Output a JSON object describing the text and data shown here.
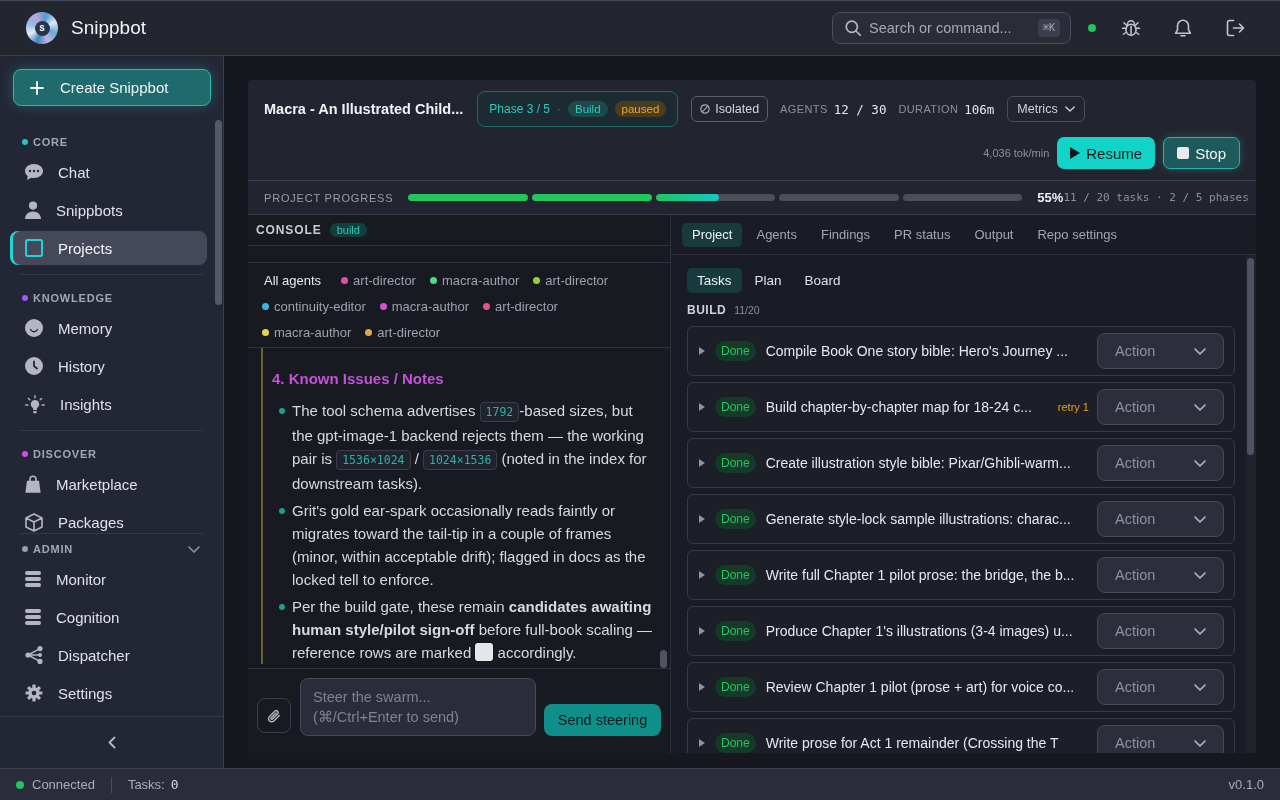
{
  "topbar": {
    "logo_letter": "s",
    "app_name": "Snippbot",
    "search": {
      "placeholder": "Search or command...",
      "shortcut": "⌘K"
    },
    "online": true
  },
  "sidebar": {
    "create_button": "Create Snippbot",
    "sections": [
      {
        "label": "CORE",
        "color": "#22c5c9",
        "items": [
          {
            "label": "Chat",
            "selected": false
          },
          {
            "label": "Snippbots",
            "selected": false
          },
          {
            "label": "Projects",
            "selected": true
          }
        ]
      },
      {
        "label": "KNOWLEDGE",
        "color": "#a855f7",
        "items": [
          {
            "label": "Memory",
            "selected": false
          },
          {
            "label": "History",
            "selected": false
          },
          {
            "label": "Insights",
            "selected": false
          }
        ]
      },
      {
        "label": "DISCOVER",
        "color": "#d14fe0",
        "items": [
          {
            "label": "Marketplace",
            "selected": false
          },
          {
            "label": "Packages",
            "selected": false
          }
        ]
      }
    ],
    "admin": {
      "label": "ADMIN",
      "color": "#9a9dab",
      "expanded": true,
      "items": [
        {
          "label": "Monitor",
          "selected": false
        },
        {
          "label": "Cognition",
          "selected": false
        },
        {
          "label": "Dispatcher",
          "selected": false
        },
        {
          "label": "Settings",
          "selected": false
        }
      ]
    }
  },
  "project": {
    "title": "Macra - An Illustrated Child...",
    "phase": "Phase 3 / 5",
    "separator": "·",
    "stage": "Build",
    "state": "paused",
    "isolation": "Isolated",
    "agents_label": "AGENTS",
    "agents": "12 / 30",
    "duration_label": "DURATION",
    "duration": "106m",
    "metrics_button": "Metrics",
    "token_rate": "4,036 tok/min",
    "buttons": [
      {
        "kind": "resume",
        "label": "Resume"
      },
      {
        "kind": "stop",
        "label": "Stop"
      }
    ]
  },
  "progress": {
    "label": "PROJECT PROGRESS",
    "segments": [
      {
        "kind": "done"
      },
      {
        "kind": "done"
      },
      {
        "kind": "active",
        "level": 0.53
      },
      {
        "kind": "pending"
      },
      {
        "kind": "pending"
      }
    ],
    "percent": "55%",
    "summary": "11 / 20 tasks · 2 / 5 phases"
  },
  "console": {
    "title": "CONSOLE",
    "stage": "build",
    "filters": [
      {
        "label": "All agents",
        "selected": true
      },
      {
        "label": "art-director",
        "color": "#e54e9f",
        "selected": false
      },
      {
        "label": "macra-author",
        "color": "#4ade80",
        "selected": false
      },
      {
        "label": "art-director",
        "color": "#8fd13f",
        "selected": false
      },
      {
        "label": "continuity-editor",
        "color": "#3bb4e0",
        "selected": false
      },
      {
        "label": "macra-author",
        "color": "#d351e0",
        "selected": false
      },
      {
        "label": "art-director",
        "color": "#e8508a",
        "selected": false
      },
      {
        "label": "macra-author",
        "color": "#e7d34a",
        "selected": false
      },
      {
        "label": "art-director",
        "color": "#e0a84a",
        "selected": false
      }
    ],
    "notes": {
      "heading": "4. Known Issues / Notes",
      "bullets": [
        [
          {
            "kind": "text",
            "text": "The tool schema advertises "
          },
          {
            "kind": "code",
            "text": "1792"
          },
          {
            "kind": "text",
            "text": "-based sizes, but the gpt-image-1 backend rejects them — the working pair is "
          },
          {
            "kind": "code",
            "text": "1536×1024"
          },
          {
            "kind": "text",
            "text": " / "
          },
          {
            "kind": "code",
            "text": "1024×1536"
          },
          {
            "kind": "text",
            "text": " (noted in the index for downstream tasks)."
          }
        ],
        [
          {
            "kind": "text",
            "text": "Grit's gold ear-spark occasionally reads faintly or migrates toward the tail-tip in a couple of frames (minor, within acceptable drift); flagged in docs as the locked tell to enforce."
          }
        ],
        [
          {
            "kind": "text",
            "text": "Per the build gate, these remain **candidates awaiting human style/pilot sign-off** before full-book scaling — reference rows are marked "
          },
          {
            "kind": "square"
          },
          {
            "kind": "text",
            "text": " accordingly."
          }
        ]
      ]
    },
    "input": {
      "placeholder": "Steer the swarm... (⌘/Ctrl+Enter to send)"
    },
    "send_button": "Send steering"
  },
  "tasks": {
    "tabs": [
      {
        "label": "Project",
        "selected": true
      },
      {
        "label": "Agents",
        "selected": false
      },
      {
        "label": "Findings",
        "selected": false
      },
      {
        "label": "PR status",
        "selected": false
      },
      {
        "label": "Output",
        "selected": false
      },
      {
        "label": "Repo settings",
        "selected": false
      }
    ],
    "views": [
      {
        "label": "Tasks",
        "selected": true
      },
      {
        "label": "Plan",
        "selected": false
      },
      {
        "label": "Board",
        "selected": false
      }
    ],
    "group": {
      "title": "BUILD",
      "count": "11/20"
    },
    "rows": [
      {
        "expanded": false,
        "status": "Done",
        "title": "Compile Book One story bible: Hero's Journey ...",
        "action": "Action"
      },
      {
        "expanded": false,
        "status": "Done",
        "title": "Build chapter-by-chapter map for 18-24 c...",
        "retry": "retry 1",
        "action": "Action"
      },
      {
        "expanded": false,
        "status": "Done",
        "title": "Create illustration style bible: Pixar/Ghibli-warm...",
        "action": "Action"
      },
      {
        "expanded": false,
        "status": "Done",
        "title": "Generate style-lock sample illustrations: charac...",
        "action": "Action"
      },
      {
        "expanded": false,
        "status": "Done",
        "title": "Write full Chapter 1 pilot prose: the bridge, the b...",
        "action": "Action"
      },
      {
        "expanded": false,
        "status": "Done",
        "title": "Produce Chapter 1's illustrations (3-4 images) u...",
        "action": "Action"
      },
      {
        "expanded": false,
        "status": "Done",
        "title": "Review Chapter 1 pilot (prose + art) for voice co...",
        "action": "Action"
      },
      {
        "expanded": false,
        "status": "Done",
        "title": "Write prose for Act 1 remainder (Crossing the T",
        "action": "Action"
      }
    ]
  },
  "status_bar": {
    "connected": true,
    "connection": "Connected",
    "tasks_label": "Tasks:",
    "tasks_count": "0",
    "version": "v0.1.0"
  }
}
